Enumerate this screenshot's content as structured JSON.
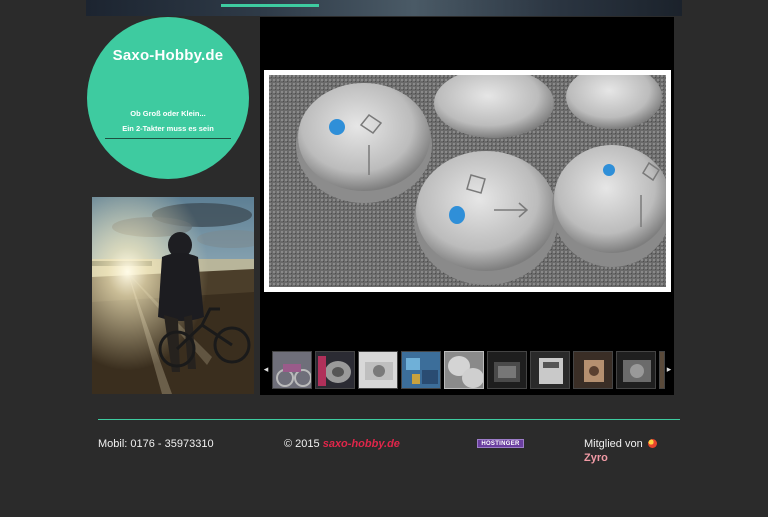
{
  "site": {
    "title": "Saxo-Hobby.de",
    "tagline_1": "Ob Groß oder Klein...",
    "tagline_2": "Ein 2-Takter muss es sein",
    "accent_color": "#3ecba0"
  },
  "gallery": {
    "prev_icon": "◂",
    "next_icon": "▸",
    "thumbnail_count": 10,
    "active_thumbnail": 5
  },
  "footer": {
    "phone": "Mobil: 0176 - 35973310",
    "copyright_prefix": "© 2015 ",
    "copyright_site": "saxo-hobby.de",
    "host_badge": "HOSTINGER",
    "member_prefix": "Mitglied von",
    "member_brand": "Zyro"
  }
}
